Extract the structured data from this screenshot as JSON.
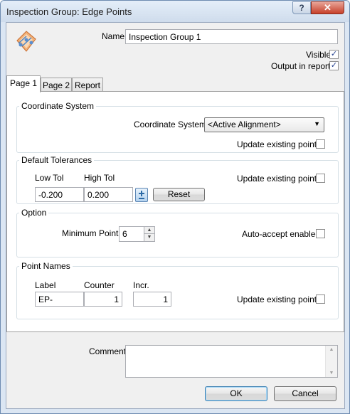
{
  "window": {
    "title": "Inspection Group: Edge Points",
    "help_glyph": "?",
    "close_glyph": "✕"
  },
  "header": {
    "name_label": "Name",
    "name_value": "Inspection Group 1",
    "visible_label": "Visible",
    "visible_checked": true,
    "output_label": "Output in report",
    "output_checked": true,
    "app_icon": "edge-points-icon"
  },
  "tabs": [
    {
      "label": "Page 1",
      "active": true
    },
    {
      "label": "Page 2",
      "active": false
    },
    {
      "label": "Report",
      "active": false
    }
  ],
  "coordinate_system": {
    "group_title": "Coordinate System",
    "label": "Coordinate System",
    "selected": "<Active Alignment>",
    "update_label": "Update existing points",
    "update_checked": false
  },
  "tolerances": {
    "group_title": "Default Tolerances",
    "low_label": "Low Tol",
    "high_label": "High Tol",
    "low_value": "-0.200",
    "high_value": "0.200",
    "swap_icon": "plus-minus-icon",
    "reset_label": "Reset",
    "update_label": "Update existing points",
    "update_checked": false
  },
  "option": {
    "group_title": "Option",
    "min_points_label": "Minimum Points",
    "min_points_value": "6",
    "auto_accept_label": "Auto-accept enabled",
    "auto_accept_checked": false
  },
  "point_names": {
    "group_title": "Point Names",
    "label_header": "Label",
    "counter_header": "Counter",
    "incr_header": "Incr.",
    "label_value": "EP-",
    "counter_value": "1",
    "incr_value": "1",
    "update_label": "Update existing points",
    "update_checked": false
  },
  "footer": {
    "comment_label": "Comment",
    "comment_value": "",
    "ok_label": "OK",
    "cancel_label": "Cancel"
  },
  "colors": {
    "frame": "#dbe6f3",
    "checkmark": "#23408e",
    "close": "#c7402a"
  }
}
